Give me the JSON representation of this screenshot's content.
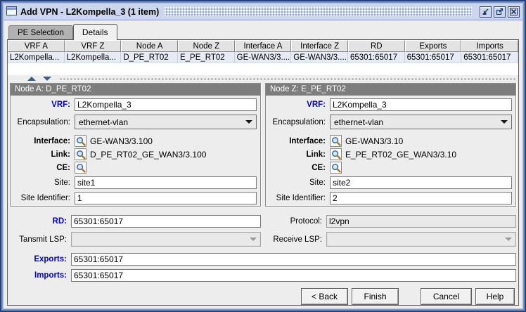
{
  "colors": {
    "label_blue": "#0000c8",
    "titlebar": "#ccd6ec",
    "frame_border": "#26407b",
    "panel_header_gray": "#7d7d7d",
    "row_selected": "#e7ebf6",
    "background": "#ededed"
  },
  "window": {
    "title": "Add VPN - L2Kompella_3 (1 item)"
  },
  "tabs": {
    "pe_selection": "PE Selection",
    "details": "Details"
  },
  "table": {
    "columns": [
      "VRF A",
      "VRF Z",
      "Node A",
      "Node Z",
      "Interface A",
      "Interface Z",
      "RD",
      "Exports",
      "Imports"
    ],
    "row": [
      "L2Kompella...",
      "L2Kompella...",
      "D_PE_RT02",
      "E_PE_RT02",
      "GE-WAN3/3....",
      "GE-WAN3/3....",
      "65301:65017",
      "65301:65017",
      "65301:65017"
    ]
  },
  "node_a": {
    "header": "Node A: D_PE_RT02",
    "vrf_label": "VRF:",
    "vrf_value": "L2Kompella_3",
    "encapsulation_label": "Encapsulation:",
    "encapsulation_value": "ethernet-vlan",
    "interface_label": "Interface:",
    "interface_value": "GE-WAN3/3.100",
    "link_label": "Link:",
    "link_value": "D_PE_RT02_GE_WAN3/3.100",
    "ce_label": "CE:",
    "site_label": "Site:",
    "site_value": "site1",
    "site_id_label": "Site Identifier:",
    "site_id_value": "1"
  },
  "node_z": {
    "header": "Node Z: E_PE_RT02",
    "vrf_label": "VRF:",
    "vrf_value": "L2Kompella_3",
    "encapsulation_label": "Encapsulation:",
    "encapsulation_value": "ethernet-vlan",
    "interface_label": "Interface:",
    "interface_value": "GE-WAN3/3.10",
    "link_label": "Link:",
    "link_value": "E_PE_RT02_GE_WAN3/3.10",
    "ce_label": "CE:",
    "site_label": "Site:",
    "site_value": "site2",
    "site_id_label": "Site Identifier:",
    "site_id_value": "2"
  },
  "fields": {
    "rd_label": "RD:",
    "rd_value": "65301:65017",
    "protocol_label": "Protocol:",
    "protocol_value": "l2vpn",
    "transmit_lsp_label": "Tansmit LSP:",
    "receive_lsp_label": "Receive LSP:",
    "exports_label": "Exports:",
    "exports_value": "65301:65017",
    "imports_label": "Imports:",
    "imports_value": "65301:65017"
  },
  "buttons": {
    "back": "< Back",
    "finish": "Finish",
    "cancel": "Cancel",
    "help": "Help"
  },
  "icons": {
    "titlebar_app": "window-icon",
    "minimize": "minimize-icon",
    "maximize": "maximize-icon",
    "close": "close-icon",
    "lookup": "search-icon",
    "dropdown": "chevron-down-icon"
  }
}
